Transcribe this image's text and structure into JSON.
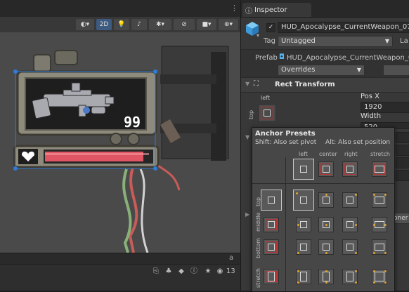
{
  "scene": {
    "toolbar": {
      "mode_2d": "2D",
      "icons": [
        "gizmo-circle-icon",
        "lightbulb-icon",
        "audio-icon",
        "effects-icon",
        "hidden-objects-icon",
        "camera-icon",
        "gizmos-icon"
      ]
    },
    "hud": {
      "ammo_count": "99",
      "health_fraction": 0.92
    },
    "bottom_bar": {
      "layer_count": "13",
      "lock_glyph": "a"
    }
  },
  "inspector": {
    "tab_label": "Inspector",
    "object_name": "HUD_Apocalypse_CurrentWeapon_07",
    "tag_label": "Tag",
    "tag_value": "Untagged",
    "layer_label": "La",
    "prefab_label": "Prefab",
    "prefab_value": "HUD_Apocalypse_CurrentWeapon_07",
    "overrides_label": "Overrides",
    "rect_transform_title": "Rect Transform",
    "anchor_corner_label": "left",
    "anchor_side_label": "top",
    "pos_x_label": "Pos X",
    "pos_x_value": "1920",
    "width_label": "Width",
    "width_value": "520",
    "component_cut": "oner"
  },
  "anchor_presets": {
    "title": "Anchor Presets",
    "hint_shift": "Shift: Also set pivot",
    "hint_alt": "Alt: Also set position",
    "columns": [
      "left",
      "center",
      "right",
      "stretch"
    ],
    "rows": [
      "top",
      "middle",
      "bottom",
      "stretch"
    ]
  },
  "colors": {
    "accent_blue": "#3d5a80",
    "health_red": "#e05563",
    "anchor_orange": "#e0a030",
    "selection_blue": "#2f7bd6"
  }
}
